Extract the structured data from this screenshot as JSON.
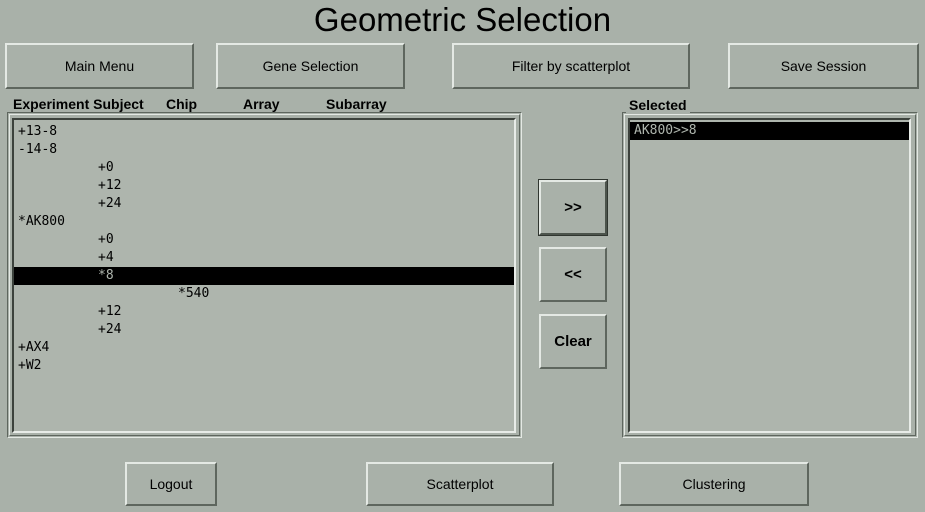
{
  "window": {
    "title": "Geometric Selection",
    "background_color": "#a9b1a9"
  },
  "toolbar": {
    "buttons": [
      {
        "label": "Main Menu",
        "name": "main-menu-button"
      },
      {
        "label": "Gene Selection",
        "name": "gene-selection-button"
      },
      {
        "label": "Filter by scatterplot",
        "name": "filter-by-scatterplot-button"
      },
      {
        "label": "Save Session",
        "name": "save-session-button"
      }
    ]
  },
  "available_panel": {
    "headers": {
      "subject": "Experiment Subject",
      "chip": "Chip",
      "array": "Array",
      "subarray": "Subarray"
    },
    "rows": [
      {
        "subject": "+13-8",
        "chip": "",
        "array": "",
        "subarray": "",
        "selected": false
      },
      {
        "subject": "-14-8",
        "chip": "",
        "array": "",
        "subarray": "",
        "selected": false
      },
      {
        "subject": "",
        "chip": "+0",
        "array": "",
        "subarray": "",
        "selected": false
      },
      {
        "subject": "",
        "chip": "+12",
        "array": "",
        "subarray": "",
        "selected": false
      },
      {
        "subject": "",
        "chip": "+24",
        "array": "",
        "subarray": "",
        "selected": false
      },
      {
        "subject": "*AK800",
        "chip": "",
        "array": "",
        "subarray": "",
        "selected": false
      },
      {
        "subject": "",
        "chip": "+0",
        "array": "",
        "subarray": "",
        "selected": false
      },
      {
        "subject": "",
        "chip": "+4",
        "array": "",
        "subarray": "",
        "selected": false
      },
      {
        "subject": "",
        "chip": "*8",
        "array": "",
        "subarray": "",
        "selected": true
      },
      {
        "subject": "",
        "chip": "",
        "array": "*540",
        "subarray": "",
        "selected": false
      },
      {
        "subject": "",
        "chip": "+12",
        "array": "",
        "subarray": "",
        "selected": false
      },
      {
        "subject": "",
        "chip": "+24",
        "array": "",
        "subarray": "",
        "selected": false
      },
      {
        "subject": "+AX4",
        "chip": "",
        "array": "",
        "subarray": "",
        "selected": false
      },
      {
        "subject": "+W2",
        "chip": "",
        "array": "",
        "subarray": "",
        "selected": false
      }
    ]
  },
  "transfer": {
    "add_label": ">>",
    "remove_label": "<<",
    "clear_label": "Clear"
  },
  "selected_panel": {
    "title": "Selected",
    "rows": [
      {
        "label": "AK800>>8",
        "selected": true
      }
    ]
  },
  "footer": {
    "buttons": [
      {
        "label": "Logout",
        "name": "logout-button"
      },
      {
        "label": "Scatterplot",
        "name": "scatterplot-button"
      },
      {
        "label": "Clustering",
        "name": "clustering-button"
      }
    ]
  }
}
